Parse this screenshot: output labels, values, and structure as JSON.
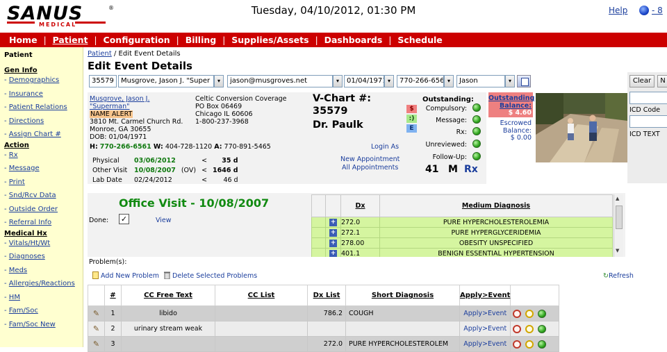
{
  "brand": {
    "logo_text": "SANUS",
    "logo_sub": "MEDICAL",
    "reg": "®"
  },
  "header": {
    "datetime": "Tuesday, 04/10/2012, 01:30 PM",
    "help": "Help",
    "user_count": "- 8"
  },
  "nav": [
    "Home",
    "Patient",
    "Configuration",
    "Billing",
    "Supplies/Assets",
    "Dashboards",
    "Schedule"
  ],
  "sidebar": {
    "title": "Patient",
    "gen_info": {
      "heading": "Gen Info",
      "items": [
        "Demographics",
        "Insurance",
        "Patient Relations",
        "Directions",
        "Assign Chart #"
      ]
    },
    "action": {
      "heading": "Action",
      "items": [
        "Rx",
        "Message",
        "Print",
        "Snd/Rcv Data",
        "Outside Order",
        "Referral Info"
      ]
    },
    "medical": {
      "heading": "Medical Hx",
      "items": [
        "Vitals/Ht/Wt",
        "Diagnoses",
        "Meds",
        "Allergies/Reactions",
        "HM",
        "Fam/Soc",
        "Fam/Soc New"
      ]
    }
  },
  "breadcrumb": {
    "link": "Patient",
    "current": " / Edit Event Details"
  },
  "page_title": "Edit Event Details",
  "search": {
    "id": "35579",
    "name": "Musgrove, Jason J. \"Super",
    "email": "jason@musgroves.net",
    "dob": "01/04/1971",
    "phone": "770-266-6561",
    "first": "Jason",
    "dd_arrow": "▾"
  },
  "patient": {
    "name_link": "Musgrove, Jason J.",
    "nickname": "\"Superman\"",
    "alert": "NAME ALERT",
    "address1": "3810 Mt. Carmel Church Rd.",
    "address2": "Monroe, GA 30655",
    "dob": "DOB: 01/04/1971",
    "ins_name": "Celtic Conversion Coverage",
    "ins_box": "PO Box 06469",
    "ins_city": "Chicago IL 60606",
    "ins_phone": "1-800-237-3968",
    "phone_h_label": "H:",
    "phone_h": "770-266-6561",
    "phone_w_label": "W:",
    "phone_w": "404-728-1120",
    "phone_a_label": "A:",
    "phone_a": "770-891-5465"
  },
  "visits": [
    {
      "label": "Physical",
      "date": "03/06/2012",
      "extra": "",
      "cmp": "<",
      "days": "35 d"
    },
    {
      "label": "Other Visit",
      "date": "10/08/2007",
      "extra": "(OV)",
      "cmp": "<",
      "days": "1646 d"
    },
    {
      "label": "Lab Date",
      "date": "02/24/2012",
      "extra": "",
      "cmp": "<",
      "days": "46 d"
    }
  ],
  "vchart": {
    "label": "V-Chart #:",
    "number": "35579",
    "doctor": "Dr. Paulk"
  },
  "badges": {
    "dollar": "$",
    "smile": ":)",
    "e": "E"
  },
  "links": {
    "login_as": "Login As",
    "new_appt": "New Appointment",
    "all_appt": "All Appointments"
  },
  "outstanding": {
    "title": "Outstanding:",
    "items": [
      "Compulsory:",
      "Message:",
      "Rx:",
      "Unreviewed:",
      "Follow-Up:"
    ],
    "age": "41",
    "sex": "M",
    "rx": "Rx"
  },
  "balance": {
    "label": "Outstanding Balance:",
    "value": "$ 4.60",
    "escrow_label": "Escrowed Balance:",
    "escrow_value": "$ 0.00",
    "color": "#ee8080"
  },
  "icd": {
    "clear": "Clear",
    "next": "N",
    "code_label": "ICD Code",
    "text_label": "ICD TEXT"
  },
  "visit": {
    "title": "Office Visit - 10/08/2007",
    "done_label": "Done:",
    "done_check": "✓",
    "view": "View"
  },
  "dx": {
    "headers": [
      "Dx",
      "Medium Diagnosis"
    ],
    "rows": [
      {
        "code": "272.0",
        "desc": "PURE HYPERCHOLESTEROLEMIA"
      },
      {
        "code": "272.1",
        "desc": "PURE HYPERGLYCERIDEMIA"
      },
      {
        "code": "278.00",
        "desc": "OBESITY UNSPECIFIED"
      },
      {
        "code": "401.1",
        "desc": "BENIGN ESSENTIAL HYPERTENSION"
      }
    ],
    "plus": "+"
  },
  "problems": {
    "label": "Problem(s):",
    "add": "Add New Problem",
    "delete": "Delete Selected Problems",
    "refresh": "Refresh",
    "headers": [
      "#",
      "CC Free Text",
      "CC List",
      "Dx List",
      "Short Diagnosis",
      "Apply>Event"
    ],
    "rows": [
      {
        "num": "1",
        "free": "libido",
        "cclist": "",
        "dx": "786.2",
        "short": "COUGH",
        "apply": "Apply>Event"
      },
      {
        "num": "2",
        "free": "urinary stream weak",
        "cclist": "",
        "dx": "",
        "short": "",
        "apply": "Apply>Event"
      },
      {
        "num": "3",
        "free": "",
        "cclist": "",
        "dx": "272.0",
        "short": "PURE HYPERCHOLESTEROLEM",
        "apply": "Apply>Event"
      }
    ]
  },
  "colors": {
    "nav": "#cc0000",
    "sidebar": "#ffffd0",
    "visit_title": "#118a11",
    "dx_row": "#d5f5a0",
    "link": "#1a3d9c"
  }
}
